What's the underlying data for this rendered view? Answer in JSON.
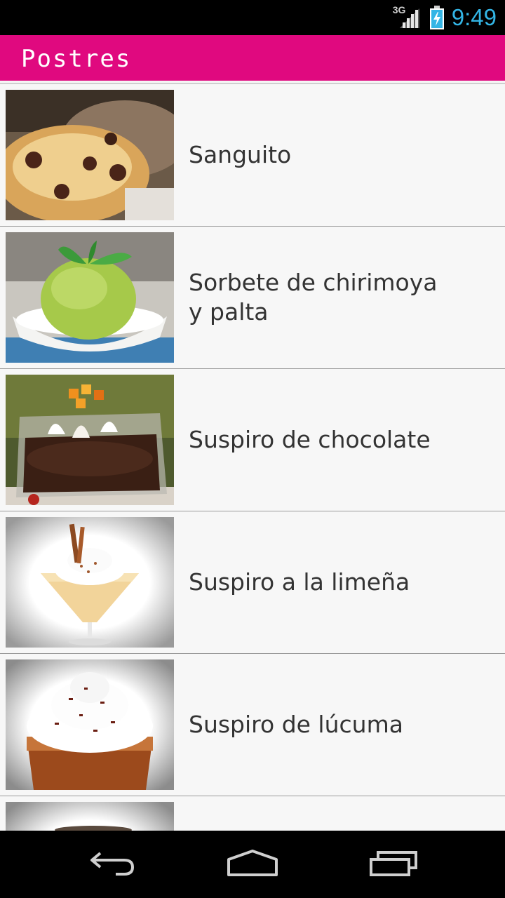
{
  "status_bar": {
    "network": "3G",
    "time": "9:49",
    "accent": "#33b5e5"
  },
  "action_bar": {
    "title": "Postres",
    "color": "#e0097f"
  },
  "items": [
    {
      "label": "Sanguito"
    },
    {
      "label": "Sorbete de chirimoya y palta"
    },
    {
      "label": "Suspiro de chocolate"
    },
    {
      "label": "Suspiro a la limeña"
    },
    {
      "label": "Suspiro de lúcuma"
    },
    {
      "label": ""
    }
  ],
  "nav_bar": {
    "icons": [
      "back-icon",
      "home-icon",
      "recent-apps-icon"
    ]
  }
}
